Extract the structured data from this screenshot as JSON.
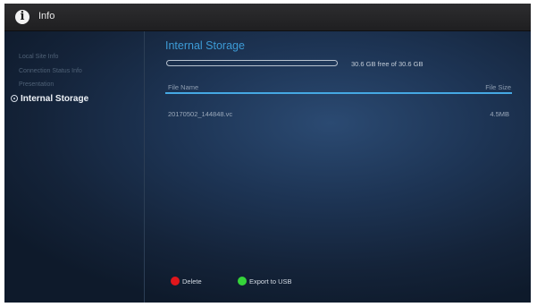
{
  "app": {
    "title": "Info",
    "icon": "info-icon"
  },
  "sidebar": {
    "items": [
      {
        "label": "Local Site Info"
      },
      {
        "label": "Connection Status Info"
      },
      {
        "label": "Presentation"
      },
      {
        "label": "Internal Storage",
        "active": true
      }
    ]
  },
  "main": {
    "title": "Internal Storage",
    "storage": {
      "text": "30.6 GB free of 30.6 GB",
      "used_fraction": 0.0
    },
    "columns": {
      "name": "File Name",
      "size": "File Size"
    },
    "files": [
      {
        "name": "20170502_144848.vc",
        "size": "4.5MB"
      }
    ]
  },
  "actions": {
    "delete": {
      "label": "Delete",
      "color": "#e0161c"
    },
    "export": {
      "label": "Export to USB",
      "color": "#35d43a"
    }
  },
  "colors": {
    "accent": "#3d9bd6"
  }
}
